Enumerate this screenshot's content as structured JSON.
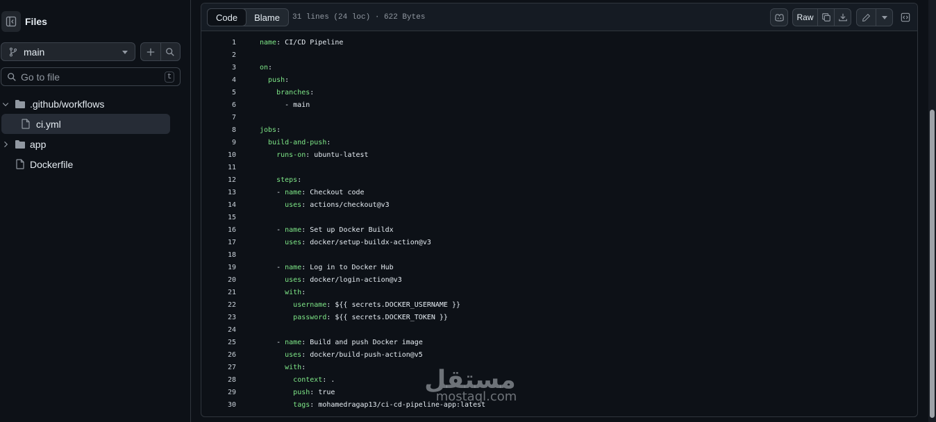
{
  "sidebar": {
    "title": "Files",
    "branch": "main",
    "search_placeholder": "Go to file",
    "search_shortcut": "t",
    "tree": [
      {
        "label": ".github/workflows",
        "type": "folder",
        "expanded": true
      },
      {
        "label": "ci.yml",
        "type": "file",
        "selected": true
      },
      {
        "label": "app",
        "type": "folder",
        "expanded": false
      },
      {
        "label": "Dockerfile",
        "type": "file"
      }
    ]
  },
  "toolbar": {
    "tab_code": "Code",
    "tab_blame": "Blame",
    "file_info": "31 lines (24 loc) · 622 Bytes",
    "raw_label": "Raw"
  },
  "code_lines": [
    {
      "n": "1",
      "indent": "",
      "key": "name",
      "sep": ": ",
      "val": "CI/CD Pipeline"
    },
    {
      "n": "2",
      "indent": "",
      "key": "",
      "sep": "",
      "val": ""
    },
    {
      "n": "3",
      "indent": "",
      "key": "on",
      "sep": ":",
      "val": ""
    },
    {
      "n": "4",
      "indent": "  ",
      "key": "push",
      "sep": ":",
      "val": ""
    },
    {
      "n": "5",
      "indent": "    ",
      "key": "branches",
      "sep": ":",
      "val": ""
    },
    {
      "n": "6",
      "indent": "      ",
      "key": "",
      "sep": "",
      "val": "- main"
    },
    {
      "n": "7",
      "indent": "",
      "key": "",
      "sep": "",
      "val": ""
    },
    {
      "n": "8",
      "indent": "",
      "key": "jobs",
      "sep": ":",
      "val": ""
    },
    {
      "n": "9",
      "indent": "  ",
      "key": "build-and-push",
      "sep": ":",
      "val": ""
    },
    {
      "n": "10",
      "indent": "    ",
      "key": "runs-on",
      "sep": ": ",
      "val": "ubuntu-latest"
    },
    {
      "n": "11",
      "indent": "",
      "key": "",
      "sep": "",
      "val": ""
    },
    {
      "n": "12",
      "indent": "    ",
      "key": "steps",
      "sep": ":",
      "val": ""
    },
    {
      "n": "13",
      "indent": "    ",
      "pre": "- ",
      "key": "name",
      "sep": ": ",
      "val": "Checkout code"
    },
    {
      "n": "14",
      "indent": "      ",
      "key": "uses",
      "sep": ": ",
      "val": "actions/checkout@v3"
    },
    {
      "n": "15",
      "indent": "",
      "key": "",
      "sep": "",
      "val": ""
    },
    {
      "n": "16",
      "indent": "    ",
      "pre": "- ",
      "key": "name",
      "sep": ": ",
      "val": "Set up Docker Buildx"
    },
    {
      "n": "17",
      "indent": "      ",
      "key": "uses",
      "sep": ": ",
      "val": "docker/setup-buildx-action@v3"
    },
    {
      "n": "18",
      "indent": "",
      "key": "",
      "sep": "",
      "val": ""
    },
    {
      "n": "19",
      "indent": "    ",
      "pre": "- ",
      "key": "name",
      "sep": ": ",
      "val": "Log in to Docker Hub"
    },
    {
      "n": "20",
      "indent": "      ",
      "key": "uses",
      "sep": ": ",
      "val": "docker/login-action@v3"
    },
    {
      "n": "21",
      "indent": "      ",
      "key": "with",
      "sep": ":",
      "val": ""
    },
    {
      "n": "22",
      "indent": "        ",
      "key": "username",
      "sep": ": ",
      "val": "${{ secrets.DOCKER_USERNAME }}"
    },
    {
      "n": "23",
      "indent": "        ",
      "key": "password",
      "sep": ": ",
      "val": "${{ secrets.DOCKER_TOKEN }}"
    },
    {
      "n": "24",
      "indent": "",
      "key": "",
      "sep": "",
      "val": ""
    },
    {
      "n": "25",
      "indent": "    ",
      "pre": "- ",
      "key": "name",
      "sep": ": ",
      "val": "Build and push Docker image"
    },
    {
      "n": "26",
      "indent": "      ",
      "key": "uses",
      "sep": ": ",
      "val": "docker/build-push-action@v5"
    },
    {
      "n": "27",
      "indent": "      ",
      "key": "with",
      "sep": ":",
      "val": ""
    },
    {
      "n": "28",
      "indent": "        ",
      "key": "context",
      "sep": ": ",
      "val": "."
    },
    {
      "n": "29",
      "indent": "        ",
      "key": "push",
      "sep": ": ",
      "val": "true"
    },
    {
      "n": "30",
      "indent": "        ",
      "key": "tags",
      "sep": ": ",
      "val": "mohamedragap13/ci-cd-pipeline-app:latest"
    }
  ],
  "watermark": {
    "main": "مستقل",
    "sub": "mostaql.com"
  },
  "colors": {
    "background": "#0d1117",
    "border": "#30363d",
    "yaml_key": "#7ee787",
    "text": "#e6edf3",
    "muted": "#9198a1"
  },
  "icons": [
    "sidebar-collapse-icon",
    "git-branch-icon",
    "plus-icon",
    "search-icon",
    "folder-icon",
    "file-icon",
    "chevron-down-icon",
    "chevron-right-icon",
    "copilot-icon",
    "copy-icon",
    "download-icon",
    "pencil-icon",
    "symbols-icon"
  ]
}
